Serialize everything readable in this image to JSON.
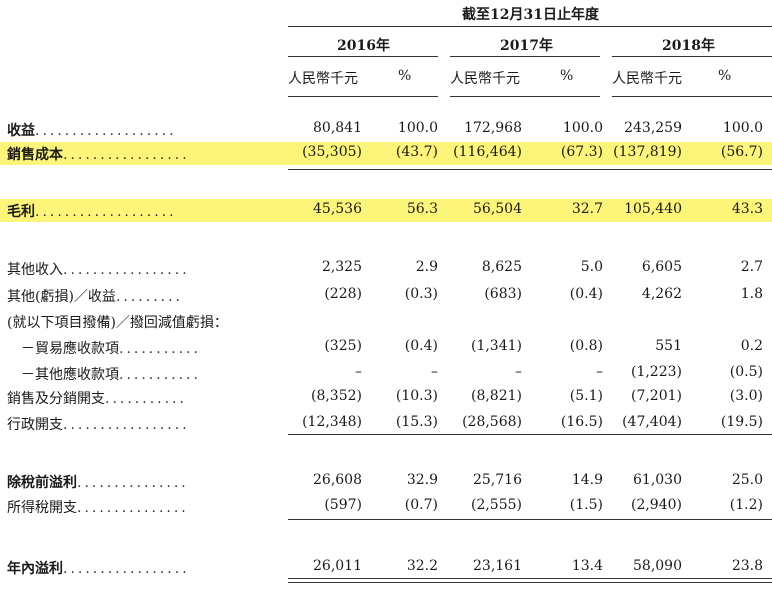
{
  "header": {
    "period": "截至12月31日止年度",
    "years": [
      "2016年",
      "2017年",
      "2018年"
    ],
    "unit_rmb": "人民幣千元",
    "unit_pct": "%"
  },
  "colors": {
    "highlight": "#fdf47a"
  },
  "rows": [
    {
      "label": "收益",
      "dots": "...................",
      "bold": true,
      "values": [
        "80,841",
        "100.0",
        "172,968",
        "100.0",
        "243,259",
        "100.0"
      ]
    },
    {
      "label": "銷售成本",
      "dots": ".................",
      "bold": true,
      "values": [
        "(35,305)",
        "(43.7)",
        "(116,464)",
        "(67.3)",
        "(137,819)",
        "(56.7)"
      ]
    },
    {
      "label": "毛利",
      "dots": "...................",
      "bold": true,
      "values": [
        "45,536",
        "56.3",
        "56,504",
        "32.7",
        "105,440",
        "43.3"
      ]
    },
    {
      "label": "其他收入",
      "dots": ".................",
      "bold": false,
      "values": [
        "2,325",
        "2.9",
        "8,625",
        "5.0",
        "6,605",
        "2.7"
      ]
    },
    {
      "label": "其他(虧損)／收益",
      "dots": ".........",
      "bold": false,
      "values": [
        "(228)",
        "(0.3)",
        "(683)",
        "(0.4)",
        "4,262",
        "1.8"
      ]
    },
    {
      "label": "(就以下項目撥備)／撥回減值虧損：",
      "dots": "",
      "bold": false,
      "values": [
        "",
        "",
        "",
        "",
        "",
        ""
      ]
    },
    {
      "label": "－貿易應收款項",
      "dots": "...........",
      "bold": false,
      "values": [
        "(325)",
        "(0.4)",
        "(1,341)",
        "(0.8)",
        "551",
        "0.2"
      ]
    },
    {
      "label": "－其他應收款項",
      "dots": "...........",
      "bold": false,
      "values": [
        "–",
        "–",
        "–",
        "–",
        "(1,223)",
        "(0.5)"
      ]
    },
    {
      "label": "銷售及分銷開支",
      "dots": "...........",
      "bold": false,
      "values": [
        "(8,352)",
        "(10.3)",
        "(8,821)",
        "(5.1)",
        "(7,201)",
        "(3.0)"
      ]
    },
    {
      "label": "行政開支",
      "dots": ".................",
      "bold": false,
      "values": [
        "(12,348)",
        "(15.3)",
        "(28,568)",
        "(16.5)",
        "(47,404)",
        "(19.5)"
      ]
    },
    {
      "label": "除稅前溢利",
      "dots": "...............",
      "bold": true,
      "values": [
        "26,608",
        "32.9",
        "25,716",
        "14.9",
        "61,030",
        "25.0"
      ]
    },
    {
      "label": "所得稅開支",
      "dots": "...............",
      "bold": false,
      "values": [
        "(597)",
        "(0.7)",
        "(2,555)",
        "(1.5)",
        "(2,940)",
        "(1.2)"
      ]
    },
    {
      "label": "年內溢利",
      "dots": ".................",
      "bold": true,
      "values": [
        "26,011",
        "32.2",
        "23,161",
        "13.4",
        "58,090",
        "23.8"
      ]
    }
  ]
}
